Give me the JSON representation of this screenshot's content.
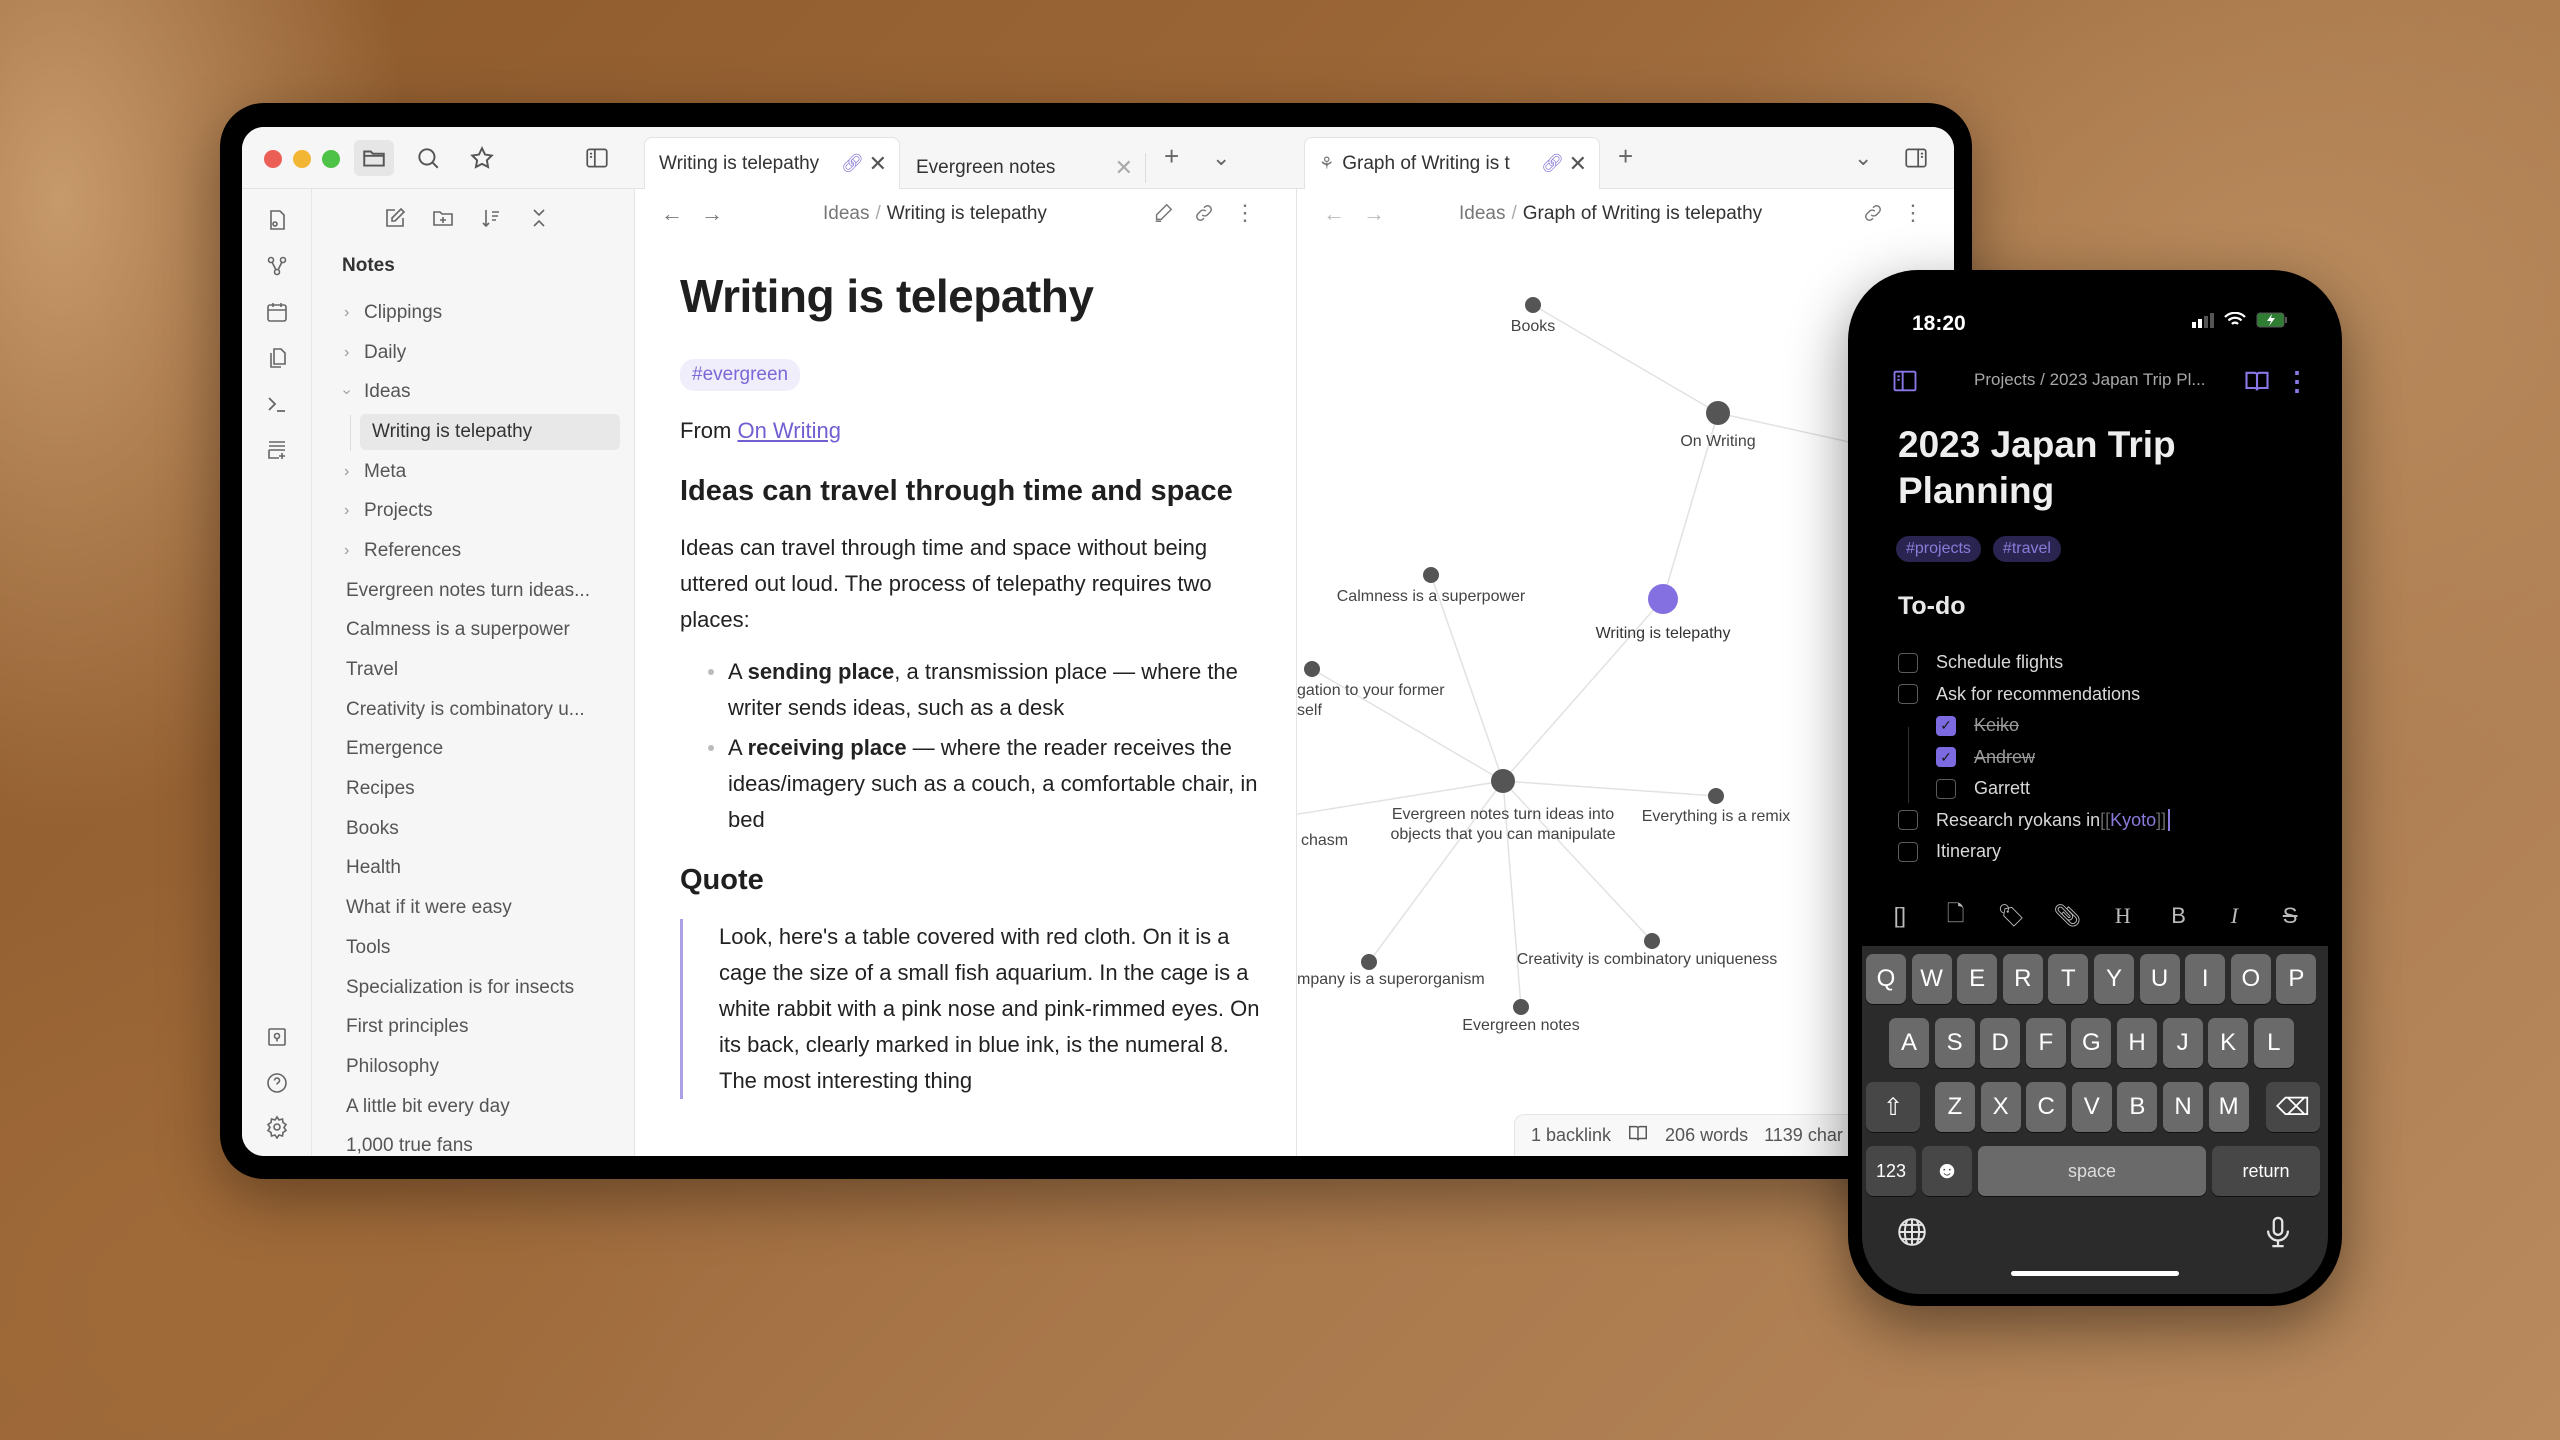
{
  "tablet": {
    "topbar": {
      "icons": [
        "folder-icon",
        "search-icon",
        "star-icon",
        "sidebar-toggle-icon"
      ],
      "left_tabs": [
        {
          "label": "Writing is telepathy",
          "active": true,
          "linked": true
        },
        {
          "label": "Evergreen notes",
          "active": false,
          "linked": false
        }
      ],
      "right_tabs": [
        {
          "label": "Graph of Writing is t",
          "active": true,
          "linked": true,
          "icon": "graph-icon"
        }
      ],
      "new_tab_symbol": "+",
      "tab_menu_symbol": "⌄",
      "close_symbol": "✕"
    },
    "icon_rail": {
      "top": [
        "quick-switcher-icon",
        "graph-view-icon",
        "daily-note-icon",
        "templates-icon",
        "command-palette-icon",
        "canvas-icon"
      ],
      "bottom": [
        "vault-icon",
        "help-icon",
        "settings-icon"
      ]
    },
    "sidebar": {
      "actions": [
        "new-note-icon",
        "new-folder-icon",
        "sort-icon",
        "collapse-all-icon"
      ],
      "title": "Notes",
      "folders": [
        {
          "label": "Clippings",
          "expanded": false
        },
        {
          "label": "Daily",
          "expanded": false
        },
        {
          "label": "Ideas",
          "expanded": true,
          "children": [
            {
              "label": "Writing is telepathy",
              "selected": true
            }
          ]
        },
        {
          "label": "Meta",
          "expanded": false
        },
        {
          "label": "Projects",
          "expanded": false
        },
        {
          "label": "References",
          "expanded": false
        }
      ],
      "files": [
        "Evergreen notes turn ideas...",
        "Calmness is a superpower",
        "Travel",
        "Creativity is combinatory u...",
        "Emergence",
        "Recipes",
        "Books",
        "Health",
        "What if it were easy",
        "Tools",
        "Specialization is for insects",
        "First principles",
        "Philosophy",
        "A little bit every day",
        "1,000 true fans"
      ]
    },
    "editor": {
      "breadcrumb": {
        "parent": "Ideas",
        "separator": "/",
        "current": "Writing is telepathy"
      },
      "title": "Writing is telepathy",
      "tag": "#evergreen",
      "from_prefix": "From ",
      "from_link": "On Writing",
      "heading1": "Ideas can travel through time and space",
      "paragraph": "Ideas can travel through time and space without being uttered out loud. The process of telepathy requires two places:",
      "bullets": [
        {
          "pre": "A ",
          "bold": "sending place",
          "post": ", a transmission place — where the writer sends ideas, such as a desk"
        },
        {
          "pre": "A ",
          "bold": "receiving place",
          "post": " — where the reader receives the ideas/imagery such as a couch, a comfortable chair, in bed"
        }
      ],
      "heading2": "Quote",
      "quote": "Look, here's a table covered with red cloth. On it is a cage the size of a small fish aquarium. In the cage is a white rabbit with a pink nose and pink-rimmed eyes. On its back, clearly marked in blue ink, is the numeral 8. The most interesting thing"
    },
    "graph_pane": {
      "breadcrumb": {
        "parent": "Ideas",
        "separator": "/",
        "current": "Graph of Writing is telepathy"
      },
      "accent": "#8470e0",
      "node_color": "#555555",
      "nodes": [
        {
          "id": "books",
          "label": "Books"
        },
        {
          "id": "onwriting",
          "label": "On Writing"
        },
        {
          "id": "calm",
          "label": "Calmness is a superpower"
        },
        {
          "id": "wit",
          "label": "Writing is telepathy",
          "active": true
        },
        {
          "id": "oblig",
          "label": "gation to your former self"
        },
        {
          "id": "evturn",
          "label": "Evergreen notes turn ideas into objects that you can manipulate"
        },
        {
          "id": "remix",
          "label": "Everything is a remix"
        },
        {
          "id": "chasm",
          "label": "chasm"
        },
        {
          "id": "company",
          "label": "mpany is a superorganism"
        },
        {
          "id": "creativity",
          "label": "Creativity is combinatory uniqueness"
        },
        {
          "id": "evnotes",
          "label": "Evergreen notes"
        }
      ],
      "edges": [
        [
          "books",
          "onwriting"
        ],
        [
          "onwriting",
          "wit"
        ],
        [
          "wit",
          "evturn"
        ],
        [
          "calm",
          "evturn"
        ],
        [
          "oblig",
          "evturn"
        ],
        [
          "chasm",
          "evturn"
        ],
        [
          "remix",
          "evturn"
        ],
        [
          "company",
          "evturn"
        ],
        [
          "creativity",
          "evturn"
        ],
        [
          "evnotes",
          "evturn"
        ],
        [
          "onwriting",
          "offscreen"
        ]
      ],
      "status": {
        "backlinks": "1 backlink",
        "words": "206 words",
        "chars": "1139 char"
      }
    }
  },
  "phone": {
    "time": "18:20",
    "breadcrumb": "Projects / 2023 Japan Trip Pl...",
    "title": "2023 Japan Trip Planning",
    "tags": [
      "#projects",
      "#travel"
    ],
    "heading": "To-do",
    "tasks": [
      {
        "text": "Schedule flights",
        "done": false,
        "level": 0
      },
      {
        "text": "Ask for recommendations",
        "done": false,
        "level": 0
      },
      {
        "text": "Keiko",
        "done": true,
        "level": 1
      },
      {
        "text": "Andrew",
        "done": true,
        "level": 1
      },
      {
        "text": "Garrett",
        "done": false,
        "level": 1
      },
      {
        "text": "Research ryokans in ",
        "link": "Kyoto",
        "done": false,
        "level": 0,
        "cursor": true
      },
      {
        "text": "Itinerary",
        "done": false,
        "level": 0
      }
    ],
    "toolbar": [
      "[]",
      "file-icon",
      "tag-icon",
      "attachment-icon",
      "H",
      "B",
      "I",
      "S"
    ],
    "keyboard": {
      "row1": [
        "Q",
        "W",
        "E",
        "R",
        "T",
        "Y",
        "U",
        "I",
        "O",
        "P"
      ],
      "row2": [
        "A",
        "S",
        "D",
        "F",
        "G",
        "H",
        "J",
        "K",
        "L"
      ],
      "row3": [
        "Z",
        "X",
        "C",
        "V",
        "B",
        "N",
        "M"
      ],
      "shift": "⇧",
      "backspace": "⌫",
      "numbers": "123",
      "emoji": "☻",
      "space": "space",
      "return": "return"
    },
    "accent": "#7c6ae0"
  }
}
